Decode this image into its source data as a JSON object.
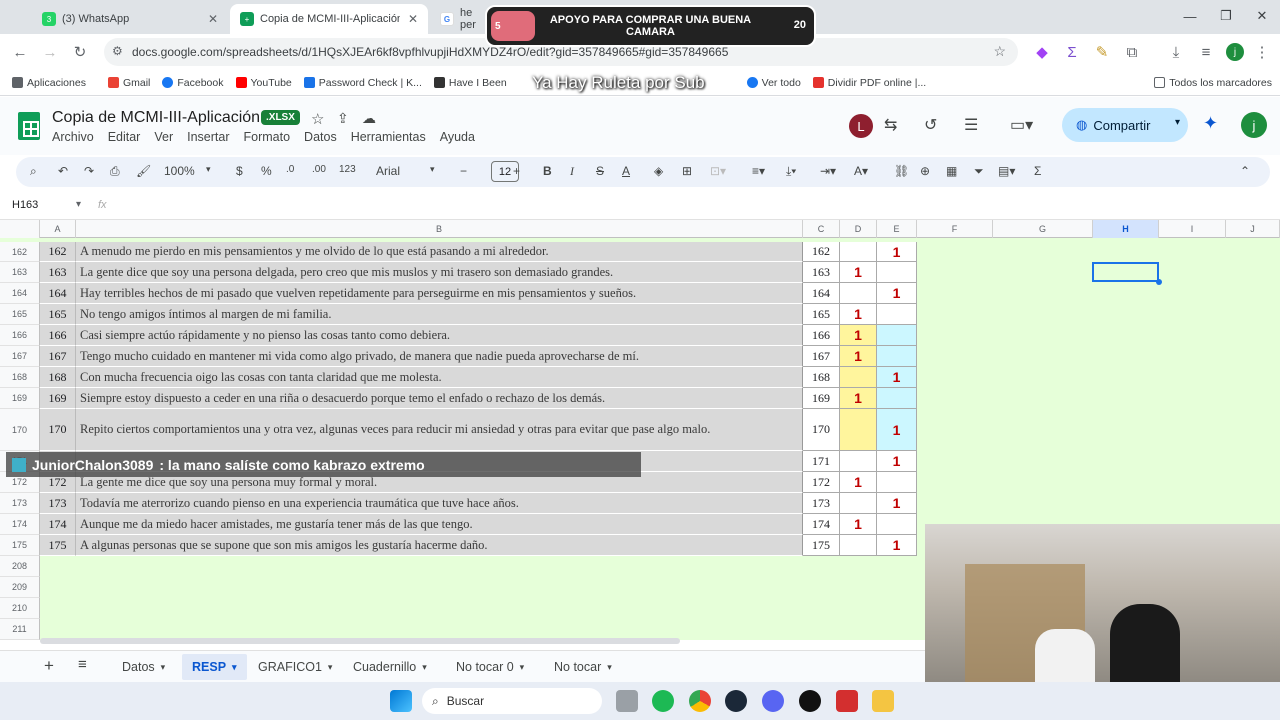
{
  "browser": {
    "tabs": [
      {
        "label": "(3) WhatsApp"
      },
      {
        "label": "Copia de MCMI-III-Aplicación.xl"
      },
      {
        "label": "he per"
      }
    ],
    "url": "docs.google.com/spreadsheets/d/1HQsXJEAr6kf8vpfhlvupjiHdXMYDZ4rO/edit?gid=357849665#gid=357849665",
    "bookmarks": [
      "Aplicaciones",
      "Gmail",
      "Facebook",
      "YouTube",
      "Password Check | K...",
      "Have I Been",
      "Ver todo",
      "Dividir PDF online |..."
    ],
    "bookmarks_right": "Todos los marcadores"
  },
  "sheets": {
    "title": "Copia de MCMI-III-Aplicación",
    "badge": ".XLSX",
    "menus": [
      "Archivo",
      "Editar",
      "Ver",
      "Insertar",
      "Formato",
      "Datos",
      "Herramientas",
      "Ayuda"
    ],
    "share_label": "Compartir",
    "avatar_left": "L",
    "avatar_right": "j",
    "zoom": "100%",
    "font": "Arial",
    "font_size": "12",
    "currency": "$",
    "percent": "%",
    "dec_less": ".0",
    "dec_more": ".00",
    "numfmt": "123",
    "namebox": "H163",
    "fx": "fx"
  },
  "columns": [
    "A",
    "B",
    "C",
    "D",
    "E",
    "F",
    "G",
    "H",
    "I",
    "J"
  ],
  "rows": [
    {
      "rownum": "162",
      "a": "162",
      "b": "A menudo me pierdo en mis pensamientos y me olvido de lo que está pasando a mi alrededor.",
      "c": "162",
      "d": "",
      "e": "1",
      "dcolor": "",
      "ecolor": ""
    },
    {
      "rownum": "163",
      "a": "163",
      "b": "La gente dice que soy una persona delgada, pero creo que mis muslos y mi trasero son demasiado grandes.",
      "c": "163",
      "d": "1",
      "e": "",
      "dcolor": "",
      "ecolor": ""
    },
    {
      "rownum": "164",
      "a": "164",
      "b": "Hay terribles hechos de mi pasado que vuelven repetidamente para perseguirme en mis pensamientos y sueños.",
      "c": "164",
      "d": "",
      "e": "1",
      "dcolor": "",
      "ecolor": ""
    },
    {
      "rownum": "165",
      "a": "165",
      "b": "No tengo amigos íntimos al margen de mi familia.",
      "c": "165",
      "d": "1",
      "e": "",
      "dcolor": "",
      "ecolor": ""
    },
    {
      "rownum": "166",
      "a": "166",
      "b": "Casi siempre actúo rápidamente y no pienso las cosas tanto como debiera.",
      "c": "166",
      "d": "1",
      "e": "",
      "dcolor": "yellow",
      "ecolor": "cyan"
    },
    {
      "rownum": "167",
      "a": "167",
      "b": "Tengo mucho cuidado en mantener mi vida como algo privado, de manera que nadie pueda aprovecharse de mí.",
      "c": "167",
      "d": "1",
      "e": "",
      "dcolor": "yellow",
      "ecolor": "cyan"
    },
    {
      "rownum": "168",
      "a": "168",
      "b": "Con mucha frecuencia oigo las cosas con tanta claridad que me molesta.",
      "c": "168",
      "d": "",
      "e": "1",
      "dcolor": "yellow",
      "ecolor": "cyan"
    },
    {
      "rownum": "169",
      "a": "169",
      "b": "Siempre estoy dispuesto a ceder en una riña o desacuerdo porque temo el enfado o rechazo de los demás.",
      "c": "169",
      "d": "1",
      "e": "",
      "dcolor": "yellow",
      "ecolor": "cyan"
    },
    {
      "rownum": "170",
      "a": "170",
      "b": "Repito ciertos comportamientos una y otra vez, algunas veces para reducir mi ansiedad y otras para evitar que pase algo malo.",
      "c": "170",
      "d": "",
      "e": "1",
      "dcolor": "yellow",
      "ecolor": "cyan"
    },
    {
      "rownum": "171",
      "a": "",
      "b": "",
      "c": "171",
      "d": "",
      "e": "1",
      "dcolor": "",
      "ecolor": ""
    },
    {
      "rownum": "172",
      "a": "172",
      "b": "La gente me dice que soy una persona muy formal y moral.",
      "c": "172",
      "d": "1",
      "e": "",
      "dcolor": "",
      "ecolor": ""
    },
    {
      "rownum": "173",
      "a": "173",
      "b": "Todavía me aterrorizo cuando pienso en una experiencia traumática que tuve hace años.",
      "c": "173",
      "d": "",
      "e": "1",
      "dcolor": "",
      "ecolor": ""
    },
    {
      "rownum": "174",
      "a": "174",
      "b": "Aunque me da miedo hacer amistades, me gustaría tener más de las que tengo.",
      "c": "174",
      "d": "1",
      "e": "",
      "dcolor": "",
      "ecolor": ""
    },
    {
      "rownum": "175",
      "a": "175",
      "b": "A algunas personas que se supone que son mis amigos les gustaría hacerme daño.",
      "c": "175",
      "d": "",
      "e": "1",
      "dcolor": "",
      "ecolor": ""
    }
  ],
  "empty_rows": [
    "208",
    "209",
    "210",
    "211"
  ],
  "sheet_tabs": [
    {
      "label": "Datos",
      "active": false
    },
    {
      "label": "RESP",
      "active": true
    },
    {
      "label": "GRAFICO1",
      "active": false
    },
    {
      "label": "Cuadernillo",
      "active": false
    },
    {
      "label": "No tocar 0",
      "active": false
    },
    {
      "label": "No tocar",
      "active": false
    }
  ],
  "taskbar": {
    "search_label": "Buscar"
  },
  "overlays": {
    "donation_text": "APOYO PARA COMPRAR UNA BUENA CAMARA",
    "donation_left": "5",
    "donation_right": "20",
    "ruleta": "Ya Hay Ruleta por Sub",
    "chat_user": "JuniorChalon3089",
    "chat_message": ": la mano salíste como kabrazo extremo"
  }
}
